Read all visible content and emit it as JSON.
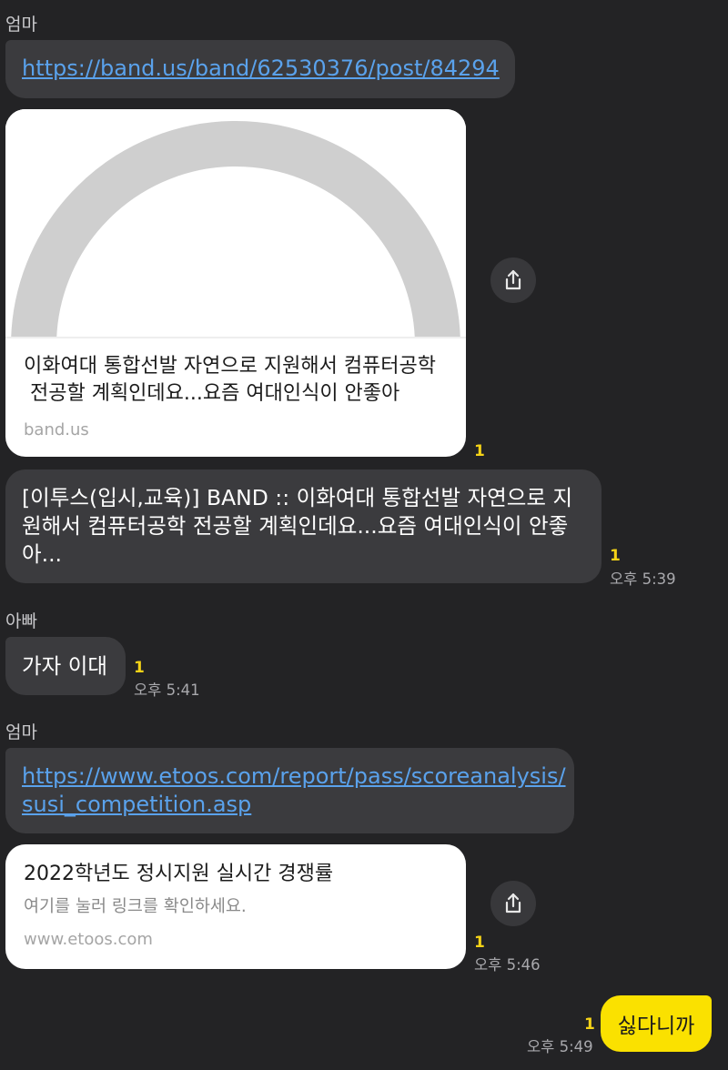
{
  "messages": {
    "m1": {
      "sender": "엄마",
      "link": "https://band.us/band/62530376/post/84294",
      "preview": {
        "title": "이화여대 통합선발 자연으로 지원해서 컴퓨터공학 전공할 계획인데요...요즘 여대인식이 안좋아",
        "title_line1": "이화여대 통합선발 자연으로 지원해서 컴퓨터공학",
        "title_line2": " 전공할 계획인데요...요즘 여대인식이 안좋아",
        "domain": "band.us",
        "unread": "1"
      },
      "text_line1": "[이투스(입시,교육)] BAND :: 이화여대 통합선발 자연으로 지",
      "text_line2": "원해서 컴퓨터공학 전공할 계획인데요...요즘 여대인식이 안좋",
      "text_line3": "아...",
      "unread": "1",
      "time": "오후 5:39"
    },
    "m2": {
      "sender": "아빠",
      "text": "가자 이대",
      "unread": "1",
      "time": "오후 5:41"
    },
    "m3": {
      "sender": "엄마",
      "link_line1": "https://www.etoos.com/report/pass/scoreanalysis/",
      "link_line2": "susi_competition.asp",
      "preview": {
        "title": "2022학년도 정시지원 실시간 경쟁률",
        "desc": "여기를 눌러 링크를 확인하세요.",
        "domain": "www.etoos.com"
      },
      "unread": "1",
      "time": "오후 5:46"
    },
    "m4": {
      "text": "싫다니까",
      "unread": "1",
      "time": "오후 5:49"
    }
  },
  "icons": {
    "share": "share-icon"
  },
  "colors": {
    "background": "#232325",
    "bubble": "#3b3b3e",
    "link": "#5aa2ec",
    "unread": "#f5d317",
    "my_bubble": "#fae100"
  }
}
